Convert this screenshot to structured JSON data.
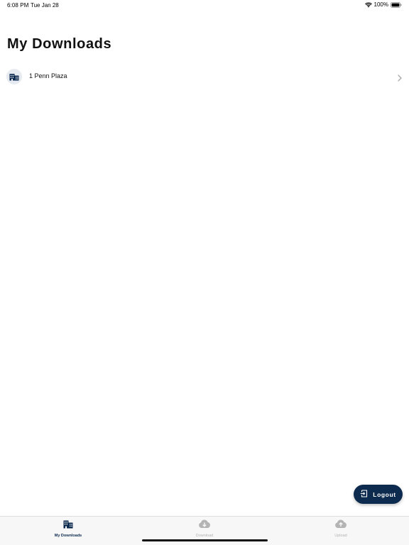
{
  "status_bar": {
    "time": "6:08 PM",
    "date": "Tue Jan 28",
    "battery_percent": "100%",
    "wifi_icon": "wifi-icon",
    "battery_icon": "battery-icon"
  },
  "page": {
    "title": "My Downloads"
  },
  "downloads": {
    "items": [
      {
        "label": "1 Penn Plaza",
        "icon": "building-icon"
      }
    ]
  },
  "logout": {
    "label": "Logout",
    "icon": "logout-icon"
  },
  "tab_bar": {
    "tabs": [
      {
        "label": "My Downloads",
        "icon": "building-icon",
        "active": true
      },
      {
        "label": "Download",
        "icon": "cloud-download-icon",
        "active": false
      },
      {
        "label": "Upload",
        "icon": "cloud-upload-icon",
        "active": false
      }
    ]
  },
  "colors": {
    "primary": "#0d2a4f",
    "inactive": "#b4b4b4",
    "icon_bg": "#e6ebf1"
  }
}
